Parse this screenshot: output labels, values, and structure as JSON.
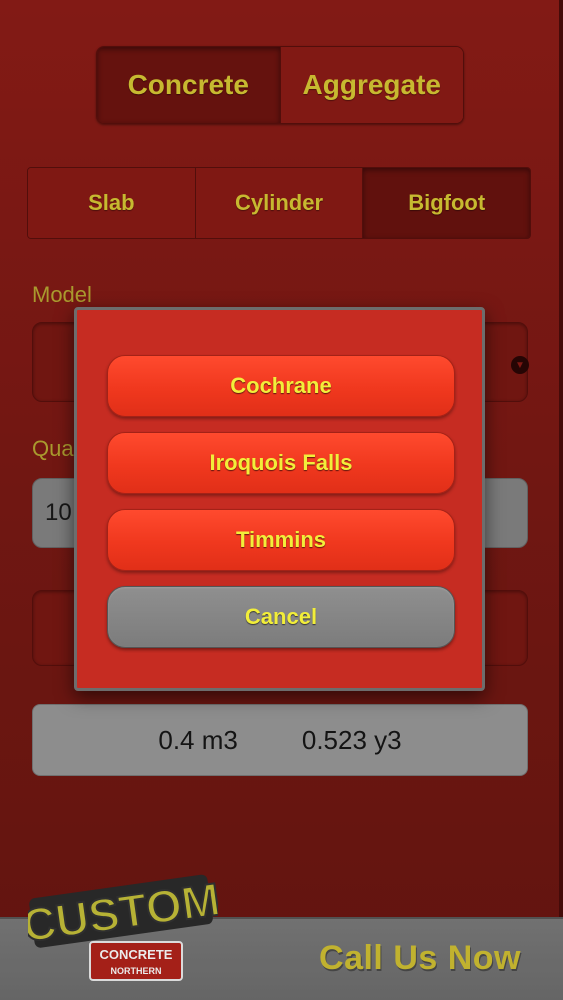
{
  "tabs_primary": {
    "items": [
      {
        "label": "Concrete",
        "active": true
      },
      {
        "label": "Aggregate",
        "active": false
      }
    ]
  },
  "tabs_secondary": {
    "items": [
      {
        "label": "Slab",
        "active": false
      },
      {
        "label": "Cylinder",
        "active": false
      },
      {
        "label": "Bigfoot",
        "active": true
      }
    ]
  },
  "form": {
    "model_label": "Model",
    "quantity_label_partial": "Qua",
    "quantity_value_partial": "10"
  },
  "result": {
    "metric": "0.4 m3",
    "imperial": "0.523 y3"
  },
  "dialog": {
    "options": [
      "Cochrane",
      "Iroquois Falls",
      "Timmins"
    ],
    "cancel_label": "Cancel"
  },
  "footer": {
    "call_label": "Call Us Now",
    "logo": {
      "main": "CUSTOM",
      "sub1": "CONCRETE",
      "sub2": "NORTHERN"
    }
  },
  "colors": {
    "background": "#7a1914",
    "accent_text": "#d8c935",
    "dialog_bg": "#c62c22",
    "dialog_button": "#f0381e",
    "dialog_text": "#f2ee3a",
    "cancel_bg": "#838383",
    "footer_bg": "#747474"
  }
}
